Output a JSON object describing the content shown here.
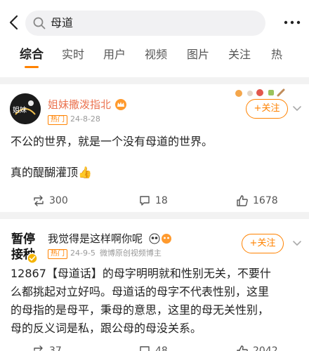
{
  "search": {
    "query": "母道"
  },
  "tabs": [
    {
      "label": "综合"
    },
    {
      "label": "实时"
    },
    {
      "label": "用户"
    },
    {
      "label": "视频"
    },
    {
      "label": "图片"
    },
    {
      "label": "关注"
    },
    {
      "label": "热"
    }
  ],
  "colors": {
    "accent": "#ff8200",
    "name_orange": "#eb7350",
    "background_gray": "#f2f2f2"
  },
  "posts": [
    {
      "author": "姐妹撒泼指北",
      "avatar_text": "姐妹",
      "badge": "热门",
      "time": "24-8-28",
      "follow_label": "+关注",
      "text_line1": "不公的世界，就是一个没有母道的世界。",
      "text_line2": "真的醍醐灌顶",
      "emoji": "👍",
      "reposts": "300",
      "comments": "18",
      "likes": "1678"
    },
    {
      "author": "我觉得是这样啊你呢",
      "avatar_text_1": "暂停",
      "avatar_text_2": "接种",
      "badge": "热门",
      "time": "24-9-5",
      "source": "微博原创视频博主",
      "follow_label": "+关注",
      "lines": [
        "12867【母道话】的母字明明就和性别无关，不要什",
        "么都挑起对立好吗。母道话的母字不代表性别，这里",
        "的母指的是母平，秉母的意思，这里的母无关性别，",
        "母的反义词是私，跟公母的母没关系。"
      ],
      "reposts": "37",
      "comments": "48",
      "likes": "2042"
    }
  ]
}
